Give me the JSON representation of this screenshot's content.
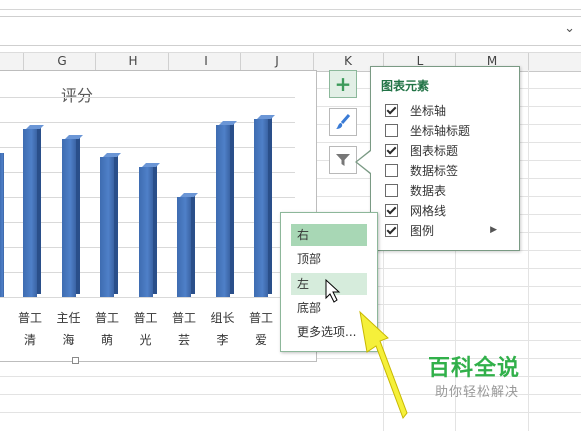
{
  "columns": [
    "G",
    "H",
    "I",
    "J",
    "K",
    "L",
    "M"
  ],
  "chart": {
    "title": "评分"
  },
  "chart_data": {
    "type": "bar",
    "title": "评分",
    "categories": [
      "普工清",
      "主任海",
      "普工萌",
      "普工光",
      "普工芸",
      "组长李",
      "普工爱"
    ],
    "category_lines": [
      [
        "普工",
        "清"
      ],
      [
        "主任",
        "海"
      ],
      [
        "普工",
        "萌"
      ],
      [
        "普工",
        "光"
      ],
      [
        "普工",
        "芸"
      ],
      [
        "组长",
        "李"
      ],
      [
        "普工",
        "爱"
      ]
    ],
    "values": [
      84,
      79,
      70,
      65,
      50,
      86,
      89
    ],
    "partial_bar_value": 72,
    "ylim": [
      0,
      100
    ],
    "grid": true,
    "legend": "none"
  },
  "side_buttons": [
    {
      "name": "chart-elements-button",
      "icon": "plus-icon"
    },
    {
      "name": "chart-styles-button",
      "icon": "brush-icon"
    },
    {
      "name": "chart-filters-button",
      "icon": "funnel-icon"
    }
  ],
  "elements_panel": {
    "title": "图表元素",
    "items": [
      {
        "label": "坐标轴",
        "checked": true
      },
      {
        "label": "坐标轴标题",
        "checked": false
      },
      {
        "label": "图表标题",
        "checked": true
      },
      {
        "label": "数据标签",
        "checked": false
      },
      {
        "label": "数据表",
        "checked": false
      },
      {
        "label": "网格线",
        "checked": true
      },
      {
        "label": "图例",
        "checked": true,
        "has_submenu": true
      }
    ]
  },
  "legend_submenu": {
    "items": [
      {
        "label": "右",
        "state": "selected"
      },
      {
        "label": "顶部",
        "state": "normal"
      },
      {
        "label": "左",
        "state": "hover"
      },
      {
        "label": "底部",
        "state": "normal"
      },
      {
        "label": "更多选项...",
        "state": "normal"
      }
    ]
  },
  "watermark": {
    "title": "百科全说",
    "subtitle": "助你轻松解决"
  },
  "colors": {
    "accent_green": "#217346",
    "bar_blue": "#4472c4",
    "arrow_yellow": "#f5f03a",
    "watermark_green": "#31b04a"
  }
}
